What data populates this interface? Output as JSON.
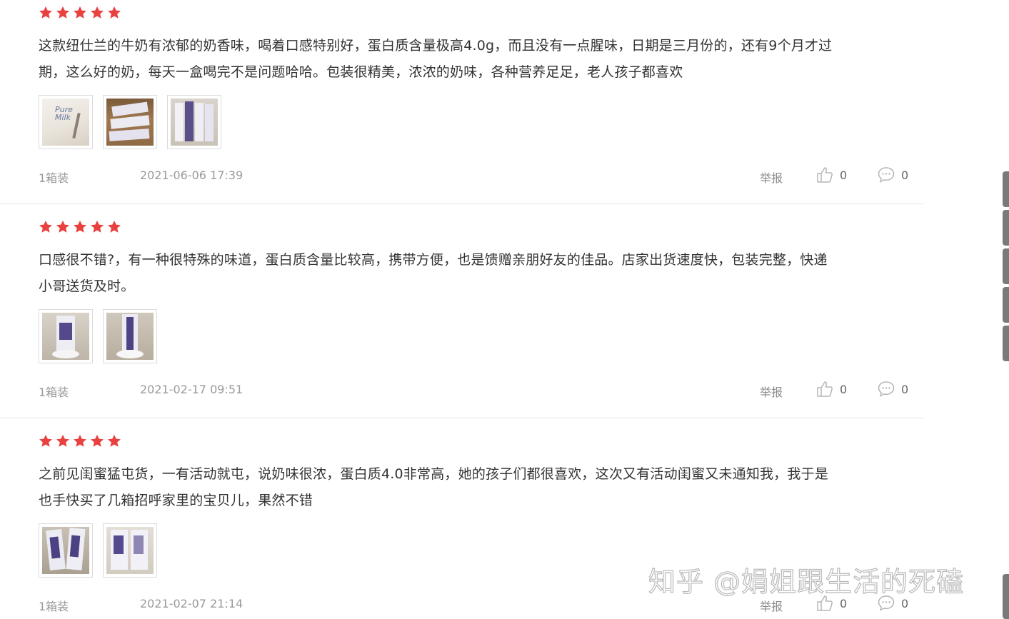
{
  "reviews": [
    {
      "rating": 5,
      "text_line1": "这款纽仕兰的牛奶有浓郁的奶香味，喝着口感特别好，蛋白质含量极高4.0g，而且没有一点腥味，日期是三月份的，还有9个月才过",
      "text_line2": "期，这么好的奶，每天一盒喝完不是问题哈哈。包装很精美，浓浓的奶味，各种营养足足，老人孩子都喜欢",
      "photos": [
        "carton-box-photo",
        "milk-cartons-box-photo",
        "milk-cartons-row-photo"
      ],
      "spec": "1箱装",
      "date": "2021-06-06 17:39",
      "report_label": "举报",
      "likes": "0",
      "comments": "0"
    },
    {
      "rating": 5,
      "text_line1": "口感很不错?，有一种很特殊的味道，蛋白质含量比较高，携带方便，也是馈赠亲朋好友的佳品。店家出货速度快，包装完整，快递",
      "text_line2": "小哥送货及时。",
      "photos": [
        "milk-carton-front-photo",
        "milk-carton-side-photo"
      ],
      "spec": "1箱装",
      "date": "2021-02-17 09:51",
      "report_label": "举报",
      "likes": "0",
      "comments": "0"
    },
    {
      "rating": 5,
      "text_line1": "之前见闺蜜猛屯货，一有活动就屯，说奶味很浓，蛋白质4.0非常高，她的孩子们都很喜欢，这次又有活动闺蜜又未通知我，我于是",
      "text_line2": "也手快买了几箱招呼家里的宝贝儿，果然不错",
      "photos": [
        "two-milk-cartons-photo",
        "milk-cartons-pair-photo"
      ],
      "spec": "1箱装",
      "date": "2021-02-07 21:14",
      "report_label": "举报",
      "likes": "0",
      "comments": "0"
    }
  ],
  "watermark": "知乎 @娟姐跟生活的死磕",
  "colors": {
    "star": "#e8413f",
    "text": "#333333",
    "meta": "#9a9a9a",
    "divider": "#e6e6e6"
  }
}
